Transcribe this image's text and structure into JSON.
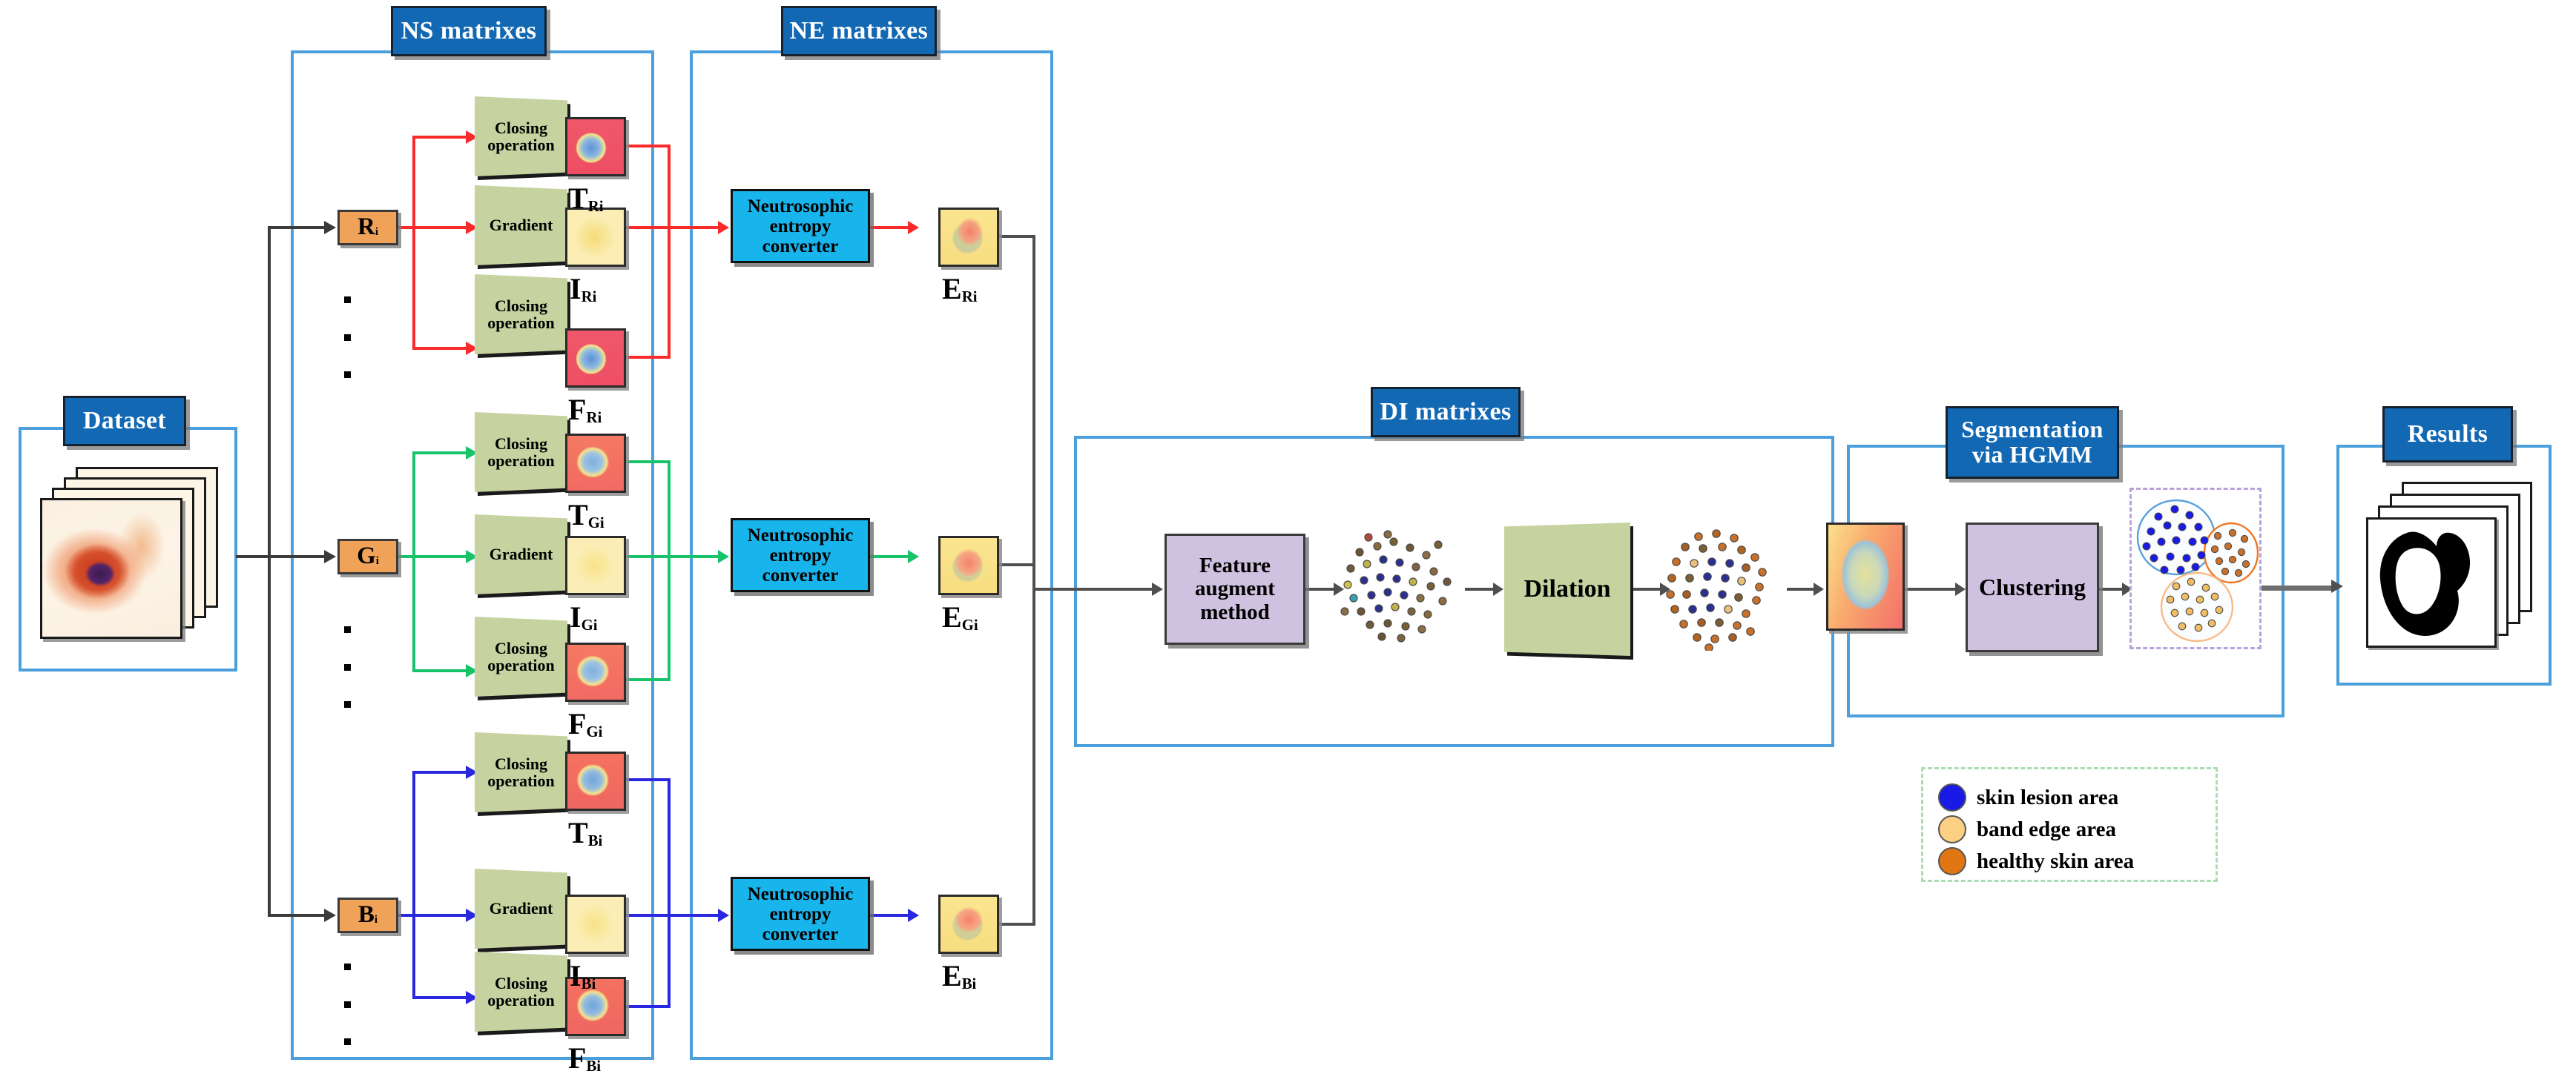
{
  "groups": {
    "dataset": {
      "title": "Dataset"
    },
    "ns": {
      "title": "NS matrixes"
    },
    "ne": {
      "title": "NE matrixes"
    },
    "di": {
      "title": "DI matrixes"
    },
    "seg": {
      "title": "Segmentation\nvia HGMM",
      "line1": "Segmentation",
      "line2": "via HGMM"
    },
    "results": {
      "title": "Results"
    }
  },
  "channels": [
    {
      "id": "R",
      "label": "R",
      "sub": "i",
      "color": "#fa2a2a"
    },
    {
      "id": "G",
      "label": "G",
      "sub": "i",
      "color": "#18c36a"
    },
    {
      "id": "B",
      "label": "B",
      "sub": "i",
      "color": "#2a27e0"
    }
  ],
  "ns_ops": {
    "closing": "Closing\noperation",
    "closing_l1": "Closing",
    "closing_l2": "operation",
    "gradient": "Gradient"
  },
  "ns_outputs": {
    "R": [
      {
        "t": "T",
        "sub": "Ri"
      },
      {
        "t": "I",
        "sub": "Ri"
      },
      {
        "t": "F",
        "sub": "Ri"
      }
    ],
    "G": [
      {
        "t": "T",
        "sub": "Gi"
      },
      {
        "t": "I",
        "sub": "Gi"
      },
      {
        "t": "F",
        "sub": "Gi"
      }
    ],
    "B": [
      {
        "t": "T",
        "sub": "Bi"
      },
      {
        "t": "I",
        "sub": "Bi"
      },
      {
        "t": "F",
        "sub": "Bi"
      }
    ]
  },
  "ne": {
    "converter_l1": "Neutrosophic",
    "converter_l2": "entropy",
    "converter_l3": "converter",
    "outputs": [
      {
        "t": "E",
        "sub": "Ri"
      },
      {
        "t": "E",
        "sub": "Gi"
      },
      {
        "t": "E",
        "sub": "Bi"
      }
    ]
  },
  "di": {
    "feature_l1": "Feature",
    "feature_l2": "augment",
    "feature_l3": "method",
    "dilation": "Dilation"
  },
  "seg": {
    "clustering": "Clustering"
  },
  "legend": {
    "items": [
      {
        "label": "skin lesion area",
        "color": "#1a1ae6"
      },
      {
        "label": "band edge area",
        "color": "#fbd083"
      },
      {
        "label": "healthy skin area",
        "color": "#e07513"
      }
    ]
  },
  "colors": {
    "chip_blue": "#1268b3",
    "group_border": "#4a9fdc",
    "process_cyan": "#18b4ec",
    "channel_orange": "#f0a259",
    "trap_green": "#c6d3a0",
    "purple_box": "#cfc2e0",
    "arrow_gray": "#5a5a5a",
    "red_path": "#fa2a2a",
    "green_path": "#18c36a",
    "blue_path": "#2a27e0"
  }
}
